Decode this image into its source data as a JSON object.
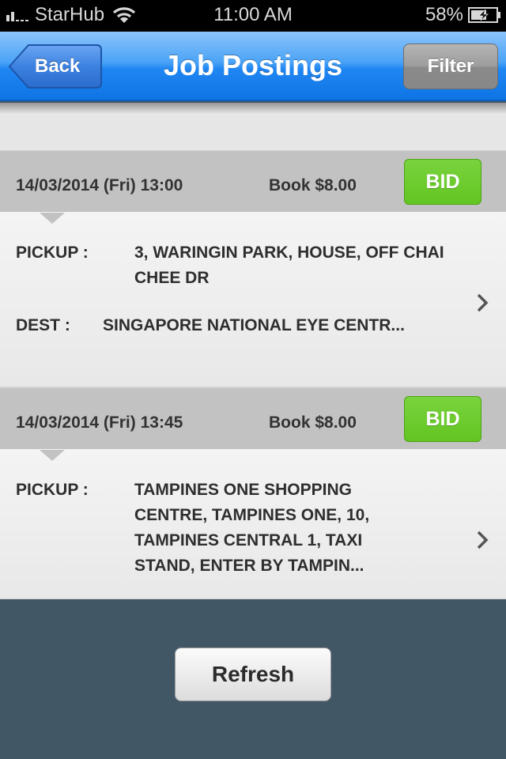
{
  "status_bar": {
    "carrier": "StarHub",
    "time": "11:00 AM",
    "battery": "58%",
    "signal_icon": "signal-bars-icon",
    "wifi_icon": "wifi-icon",
    "battery_icon": "battery-charging-icon"
  },
  "nav": {
    "back_label": "Back",
    "title": "Job Postings",
    "filter_label": "Filter"
  },
  "jobs": [
    {
      "datetime": "14/03/2014 (Fri) 13:00",
      "price": "Book $8.00",
      "bid_label": "BID",
      "pickup_label": "PICKUP :",
      "pickup": "3, WARINGIN PARK, HOUSE, OFF CHAI CHEE DR",
      "dest_label": "DEST :",
      "dest": "SINGAPORE NATIONAL EYE CENTR..."
    },
    {
      "datetime": "14/03/2014 (Fri) 13:45",
      "price": "Book $8.00",
      "bid_label": "BID",
      "pickup_label": "PICKUP :",
      "pickup": "TAMPINES ONE SHOPPING CENTRE, TAMPINES ONE, 10, TAMPINES CENTRAL 1, TAXI STAND, ENTER BY TAMPIN..."
    }
  ],
  "footer": {
    "refresh_label": "Refresh"
  },
  "colors": {
    "nav_blue": "#1f86f2",
    "bid_green": "#63c522",
    "footer_bg": "#425766"
  }
}
